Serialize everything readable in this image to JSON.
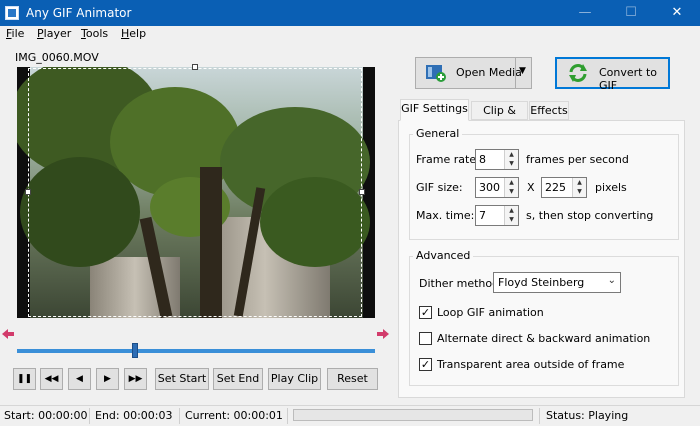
{
  "window": {
    "title": "Any GIF Animator",
    "minimize": "—",
    "maximize": "☐",
    "close": "✕"
  },
  "menu": [
    {
      "label": "File",
      "accel": "F",
      "rest": "ile"
    },
    {
      "label": "Player",
      "accel": "P",
      "rest": "layer"
    },
    {
      "label": "Tools",
      "accel": "T",
      "rest": "ools"
    },
    {
      "label": "Help",
      "accel": "H",
      "rest": "elp"
    }
  ],
  "player": {
    "filename": "IMG_0060.MOV",
    "position": 0.33,
    "buttons": {
      "pause": "❚❚",
      "first": "◀◀",
      "prev": "◀",
      "next": "▶",
      "last": "▶▶",
      "set_start": "Set Start",
      "set_end": "Set End",
      "play_clip": "Play Clip",
      "reset": "Reset"
    }
  },
  "actions": {
    "open_media": "Open Media",
    "dropdown": "▼",
    "convert": "Convert to GIF"
  },
  "tabs": [
    "GIF Settings",
    "Clip & Crop",
    "Effects"
  ],
  "general": {
    "title": "General",
    "frame_rate": {
      "label": "Frame rate:",
      "value": "8",
      "suffix": "frames per second"
    },
    "gif_size": {
      "label": "GIF size:",
      "width": "300",
      "x": "X",
      "height": "225",
      "suffix": "pixels"
    },
    "max_time": {
      "label": "Max. time:",
      "value": "7",
      "suffix": "s, then stop converting"
    }
  },
  "advanced": {
    "title": "Advanced",
    "dither": {
      "label": "Dither method:",
      "value": "Floyd Steinberg"
    },
    "loop": {
      "label": "Loop GIF animation",
      "checked": true
    },
    "alternate": {
      "label": "Alternate direct & backward animation",
      "checked": false
    },
    "transparent": {
      "label": "Transparent area outside of frame",
      "checked": true
    }
  },
  "spin_arrows": {
    "up": "▲",
    "down": "▼"
  },
  "status": {
    "start": "Start: 00:00:00",
    "end": "End: 00:00:03",
    "current": "Current: 00:00:01",
    "state": "Status: Playing"
  },
  "colors": {
    "titlebar": "#0a5fb4",
    "accent": "#3a8fd8",
    "convert_border": "#0078d7"
  }
}
